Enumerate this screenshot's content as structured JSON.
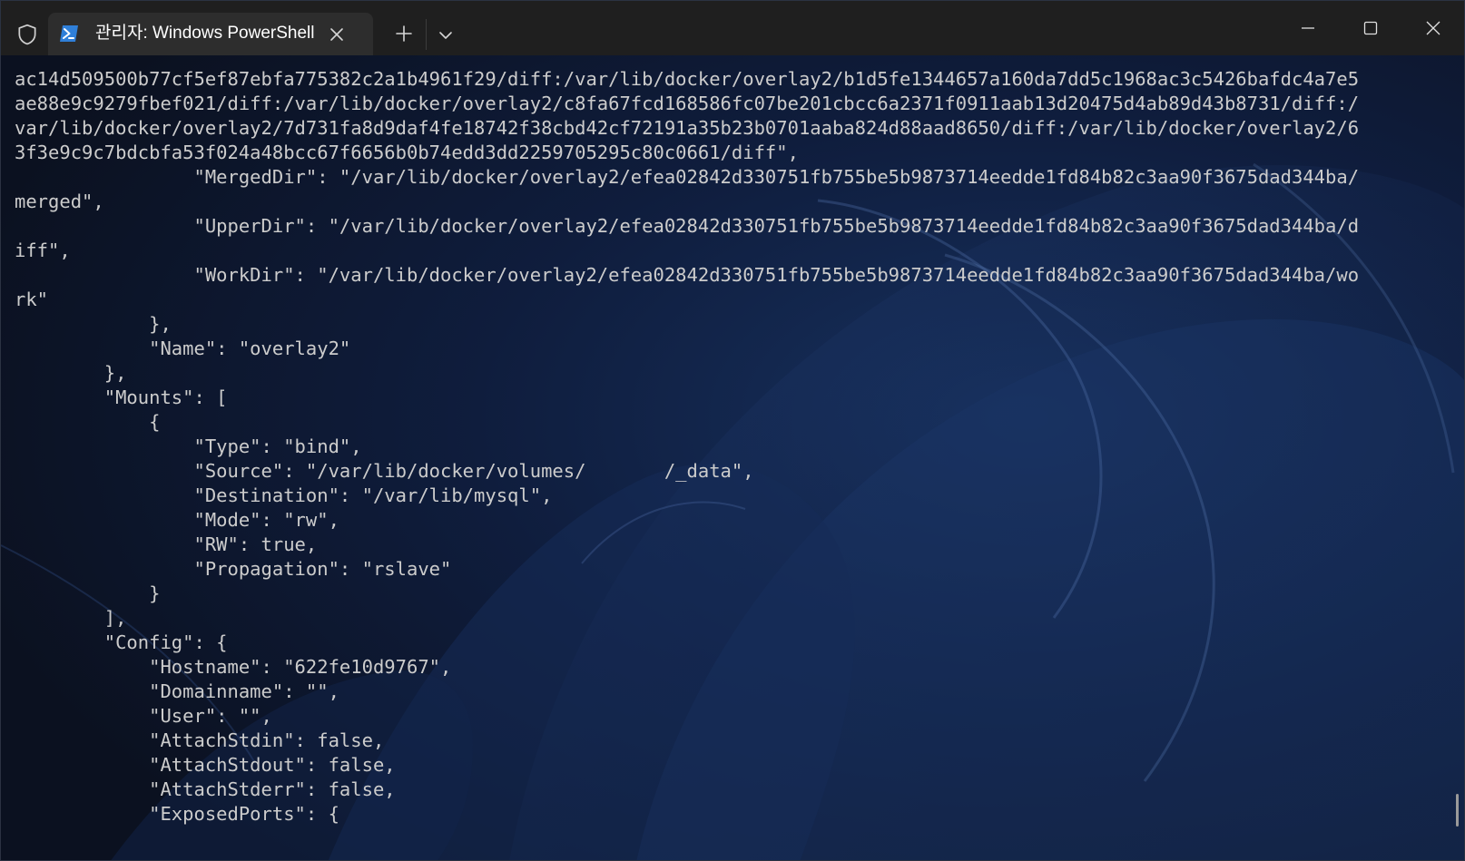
{
  "window": {
    "tab_title": "관리자: Windows PowerShell"
  },
  "icons": {
    "shield": "shield-icon",
    "powershell": "powershell-icon",
    "tab_close": "close-icon",
    "new_tab": "plus-icon",
    "dropdown": "chevron-down-icon",
    "minimize": "minimize-icon",
    "maximize": "maximize-icon",
    "close": "close-icon"
  },
  "colors": {
    "titlebar": "#1f1f1f",
    "tab": "#2d2d2d",
    "terminal_text": "#cccccc",
    "terminal_bg": "#0c1220"
  },
  "terminal": {
    "lines": [
      "ac14d509500b77cf5ef87ebfa775382c2a1b4961f29/diff:/var/lib/docker/overlay2/b1d5fe1344657a160da7dd5c1968ac3c5426bafdc4a7e5",
      "ae88e9c9279fbef021/diff:/var/lib/docker/overlay2/c8fa67fcd168586fc07be201cbcc6a2371f0911aab13d20475d4ab89d43b8731/diff:/",
      "var/lib/docker/overlay2/7d731fa8d9daf4fe18742f38cbd42cf72191a35b23b0701aaba824d88aad8650/diff:/var/lib/docker/overlay2/6",
      "3f3e9c9c7bdcbfa53f024a48bcc67f6656b0b74edd3dd2259705295c80c0661/diff\",",
      "                \"MergedDir\": \"/var/lib/docker/overlay2/efea02842d330751fb755be5b9873714eedde1fd84b82c3aa90f3675dad344ba/",
      "merged\",",
      "                \"UpperDir\": \"/var/lib/docker/overlay2/efea02842d330751fb755be5b9873714eedde1fd84b82c3aa90f3675dad344ba/d",
      "iff\",",
      "                \"WorkDir\": \"/var/lib/docker/overlay2/efea02842d330751fb755be5b9873714eedde1fd84b82c3aa90f3675dad344ba/wo",
      "rk\"",
      "            },",
      "            \"Name\": \"overlay2\"",
      "        },",
      "        \"Mounts\": [",
      "            {",
      "                \"Type\": \"bind\",",
      "                \"Source\": \"/var/lib/docker/volumes/       /_data\",",
      "                \"Destination\": \"/var/lib/mysql\",",
      "                \"Mode\": \"rw\",",
      "                \"RW\": true,",
      "                \"Propagation\": \"rslave\"",
      "            }",
      "        ],",
      "        \"Config\": {",
      "            \"Hostname\": \"622fe10d9767\",",
      "            \"Domainname\": \"\",",
      "            \"User\": \"\",",
      "            \"AttachStdin\": false,",
      "            \"AttachStdout\": false,",
      "            \"AttachStderr\": false,",
      "            \"ExposedPorts\": {"
    ]
  }
}
